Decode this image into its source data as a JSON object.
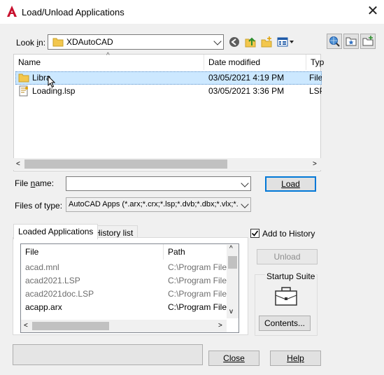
{
  "window": {
    "title": "Load/Unload Applications",
    "close_glyph": "✕"
  },
  "look_in": {
    "label_prefix": "Look ",
    "label_underline": "i",
    "label_suffix": "n:",
    "value": "XDAutoCAD"
  },
  "file_list": {
    "columns": [
      "Name",
      "Date modified",
      "Typ"
    ],
    "rows": [
      {
        "name": "Libra",
        "date": "03/05/2021 4:19 PM",
        "type": "File",
        "icon": "folder-icon",
        "selected": true
      },
      {
        "name": "Loading.lsp",
        "date": "03/05/2021 3:36 PM",
        "type": "LSP",
        "icon": "lsp-file-icon",
        "selected": false
      }
    ]
  },
  "file_name": {
    "label_prefix": "File ",
    "label_underline": "n",
    "label_suffix": "ame:",
    "value": ""
  },
  "file_type": {
    "label": "Files of type:",
    "value": "AutoCAD Apps (*.arx;*.crx;*.lsp;*.dvb;*.dbx;*.vlx;*.fa"
  },
  "buttons": {
    "load": "Load",
    "unload": "Unload",
    "contents": "Contents...",
    "close": "Close",
    "help": "Help"
  },
  "add_to_history": {
    "label": "Add to History",
    "checked": true
  },
  "tabs": [
    "Loaded Applications",
    "History list"
  ],
  "loaded_apps": {
    "columns": [
      "File",
      "Path"
    ],
    "rows": [
      {
        "file": "acad.mnl",
        "path": "C:\\Program Files\\",
        "dim": true
      },
      {
        "file": "acad2021.LSP",
        "path": "C:\\Program Files\\",
        "dim": true
      },
      {
        "file": "acad2021doc.LSP",
        "path": "C:\\Program Files\\",
        "dim": true
      },
      {
        "file": "acapp.arx",
        "path": "C:\\Program Files\\",
        "dim": false
      }
    ]
  },
  "startup_suite": {
    "label": "Startup Suite"
  },
  "colors": {
    "selection": "#cce8ff",
    "accent": "#0078d7",
    "app_red": "#c8102e"
  }
}
